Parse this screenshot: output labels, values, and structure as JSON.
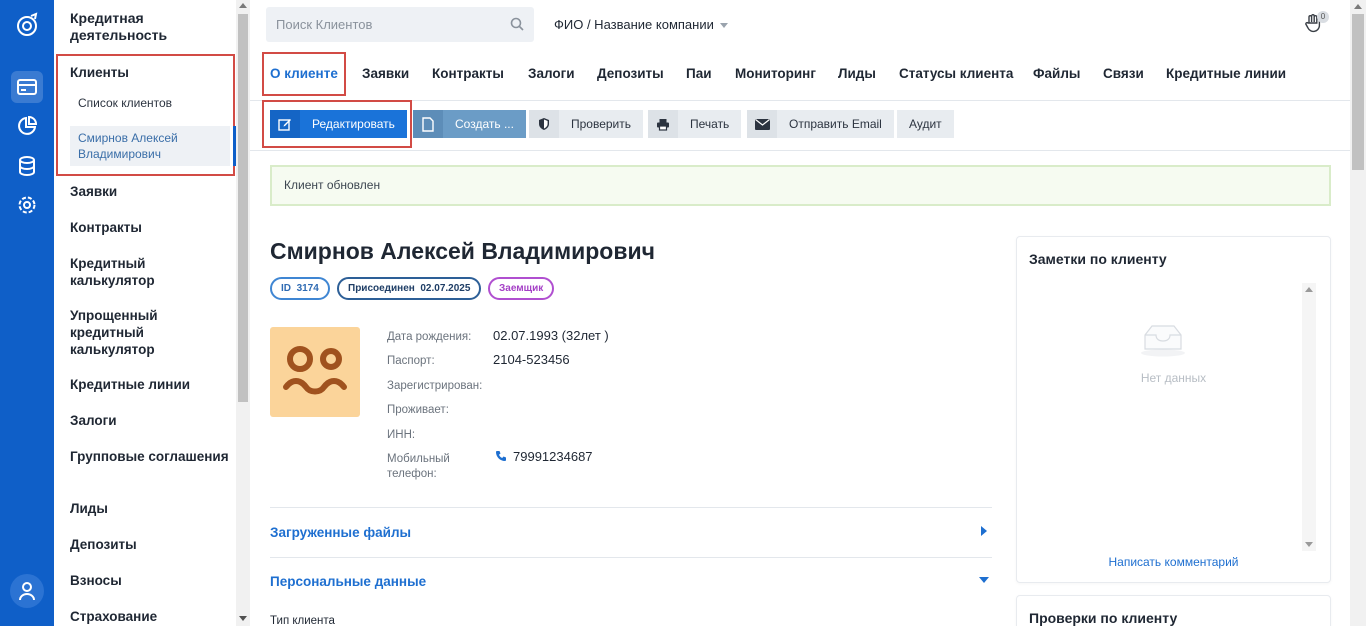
{
  "sidebar": {
    "section_title": "Кредитная деятельность",
    "clients": {
      "label": "Клиенты",
      "sub_list": "Список клиентов",
      "sub_active": "Смирнов Алексей Владимирович"
    },
    "items": [
      "Заявки",
      "Контракты",
      "Кредитный калькулятор",
      "Упрощенный кредитный калькулятор",
      "Кредитные линии",
      "Залоги",
      "Групповые соглашения",
      "Лиды",
      "Депозиты",
      "Взносы",
      "Страхование"
    ]
  },
  "header": {
    "search_placeholder": "Поиск Клиентов",
    "search_mode": "ФИО / Название компании",
    "notifications_count": "0"
  },
  "tabs": [
    "О клиенте",
    "Заявки",
    "Контракты",
    "Залоги",
    "Депозиты",
    "Паи",
    "Мониторинг",
    "Лиды",
    "Статусы клиента",
    "Файлы",
    "Связи",
    "Кредитные линии"
  ],
  "toolbar": {
    "edit": "Редактировать",
    "create": "Создать ...",
    "check": "Проверить",
    "print": "Печать",
    "email": "Отправить Email",
    "audit": "Аудит"
  },
  "alert": "Клиент обновлен",
  "client": {
    "name": "Смирнов Алексей Владимирович",
    "id_label": "ID",
    "id": "3174",
    "joined_label": "Присоединен",
    "joined": "02.07.2025",
    "role": "Заемщик",
    "fields": {
      "birth_label": "Дата рождения:",
      "birth_value": "02.07.1993 (32лет )",
      "passport_label": "Паспорт:",
      "passport_value": "2104-523456",
      "registered_label": "Зарегистрирован:",
      "lives_label": "Проживает:",
      "inn_label": "ИНН:",
      "mobile_label_1": "Мобильный",
      "mobile_label_2": "телефон:",
      "mobile_value": "79991234687"
    }
  },
  "sections": {
    "files": "Загруженные файлы",
    "personal": "Персональные данные",
    "client_type_label": "Тип клиента"
  },
  "notes": {
    "title": "Заметки по клиенту",
    "empty": "Нет данных",
    "write": "Написать комментарий"
  },
  "checks": {
    "title": "Проверки по клиенту"
  },
  "colors": {
    "rail": "#0f5fc8",
    "accent": "#1e6fd0",
    "highlight_box": "#d24b45",
    "alert_bg": "#f6fbf1",
    "avatar_bg": "#fbd49a"
  }
}
